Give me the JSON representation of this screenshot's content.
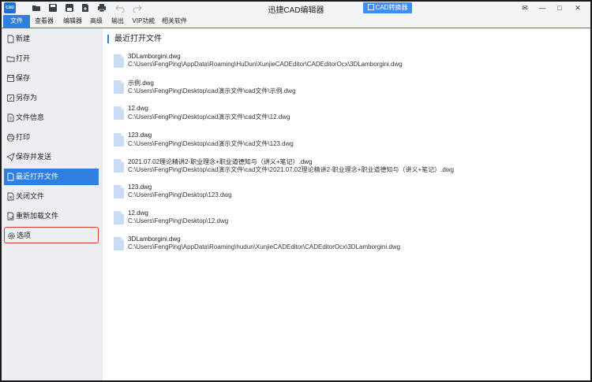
{
  "window": {
    "app_logo": "CAD",
    "title": "迅捷CAD编辑器",
    "converter_label": "CAD转换器",
    "controls": {
      "mail": "✉",
      "minimize": "—",
      "maximize": "□",
      "close": "✕"
    }
  },
  "quick_access": [
    "folder-icon",
    "save-icon",
    "save-as-icon",
    "export-icon",
    "print-icon",
    "undo-icon",
    "redo-icon"
  ],
  "menu": {
    "items": [
      {
        "label": "文件",
        "active": true
      },
      {
        "label": "查看器"
      },
      {
        "label": "编辑器"
      },
      {
        "label": "高级"
      },
      {
        "label": "输出"
      },
      {
        "label": "VIP功能"
      },
      {
        "label": "相关软件"
      }
    ]
  },
  "sidebar": {
    "items": [
      {
        "label": "新建",
        "icon": "new-file-icon"
      },
      {
        "label": "打开",
        "icon": "open-icon"
      },
      {
        "label": "保存",
        "icon": "save-icon"
      },
      {
        "label": "另存为",
        "icon": "save-as-icon"
      },
      {
        "label": "文件信息",
        "icon": "file-info-icon"
      },
      {
        "label": "打印",
        "icon": "print-icon"
      },
      {
        "label": "保存并发送",
        "icon": "save-send-icon"
      },
      {
        "label": "最近打开文件",
        "icon": "recent-files-icon",
        "active": true
      },
      {
        "label": "关闭文件",
        "icon": "close-file-icon"
      },
      {
        "label": "重新加载文件",
        "icon": "reload-icon"
      },
      {
        "label": "选项",
        "icon": "gear-icon",
        "highlighted": true
      }
    ]
  },
  "main": {
    "section_title": "最近打开文件",
    "recent_files": [
      {
        "name": "3DLamborgini.dwg",
        "path": "C:\\Users\\FengPing\\AppData\\Roaming\\HuDun\\XunjieCADEditor\\CADEditorOcx\\3DLamborgini.dwg"
      },
      {
        "name": "示例.dwg",
        "path": "C:\\Users\\FengPing\\Desktop\\cad演示文件\\cad文件\\示例.dwg"
      },
      {
        "name": "12.dwg",
        "path": "C:\\Users\\FengPing\\Desktop\\cad演示文件\\cad文件\\12.dwg"
      },
      {
        "name": "123.dwg",
        "path": "C:\\Users\\FengPing\\Desktop\\cad演示文件\\cad文件\\123.dwg"
      },
      {
        "name": "2021.07.02理论精讲2-职业理念+职业道德知与（讲义+笔记）.dwg",
        "path": "C:\\Users\\FengPing\\Desktop\\cad演示文件\\cad文件\\2021.07.02理论精讲2-职业理念+职业道德知与（讲义+笔记）.dwg"
      },
      {
        "name": "123.dwg",
        "path": "C:\\Users\\FengPing\\Desktop\\123.dwg"
      },
      {
        "name": "12.dwg",
        "path": "C:\\Users\\FengPing\\Desktop\\12.dwg"
      },
      {
        "name": "3DLamborgini.dwg",
        "path": "C:\\Users\\FengPing\\AppData\\Roaming\\hudun\\XunjieCADEditor\\CADEditorOcx\\3DLamborgini.dwg"
      }
    ]
  },
  "colors": {
    "accent": "#2f7fe0",
    "highlight_border": "#d93a2b",
    "sidebar_bg": "#eceef1",
    "file_icon": "#c9dcf4"
  }
}
